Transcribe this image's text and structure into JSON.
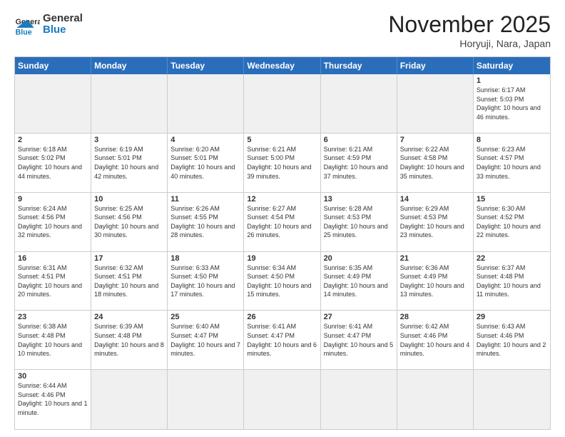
{
  "header": {
    "logo_general": "General",
    "logo_blue": "Blue",
    "month_title": "November 2025",
    "location": "Horyuji, Nara, Japan"
  },
  "day_headers": [
    "Sunday",
    "Monday",
    "Tuesday",
    "Wednesday",
    "Thursday",
    "Friday",
    "Saturday"
  ],
  "cells": [
    {
      "date": "",
      "empty": true,
      "info": ""
    },
    {
      "date": "",
      "empty": true,
      "info": ""
    },
    {
      "date": "",
      "empty": true,
      "info": ""
    },
    {
      "date": "",
      "empty": true,
      "info": ""
    },
    {
      "date": "",
      "empty": true,
      "info": ""
    },
    {
      "date": "",
      "empty": true,
      "info": ""
    },
    {
      "date": "1",
      "empty": false,
      "info": "Sunrise: 6:17 AM\nSunset: 5:03 PM\nDaylight: 10 hours and 46 minutes."
    },
    {
      "date": "2",
      "empty": false,
      "info": "Sunrise: 6:18 AM\nSunset: 5:02 PM\nDaylight: 10 hours and 44 minutes."
    },
    {
      "date": "3",
      "empty": false,
      "info": "Sunrise: 6:19 AM\nSunset: 5:01 PM\nDaylight: 10 hours and 42 minutes."
    },
    {
      "date": "4",
      "empty": false,
      "info": "Sunrise: 6:20 AM\nSunset: 5:01 PM\nDaylight: 10 hours and 40 minutes."
    },
    {
      "date": "5",
      "empty": false,
      "info": "Sunrise: 6:21 AM\nSunset: 5:00 PM\nDaylight: 10 hours and 39 minutes."
    },
    {
      "date": "6",
      "empty": false,
      "info": "Sunrise: 6:21 AM\nSunset: 4:59 PM\nDaylight: 10 hours and 37 minutes."
    },
    {
      "date": "7",
      "empty": false,
      "info": "Sunrise: 6:22 AM\nSunset: 4:58 PM\nDaylight: 10 hours and 35 minutes."
    },
    {
      "date": "8",
      "empty": false,
      "info": "Sunrise: 6:23 AM\nSunset: 4:57 PM\nDaylight: 10 hours and 33 minutes."
    },
    {
      "date": "9",
      "empty": false,
      "info": "Sunrise: 6:24 AM\nSunset: 4:56 PM\nDaylight: 10 hours and 32 minutes."
    },
    {
      "date": "10",
      "empty": false,
      "info": "Sunrise: 6:25 AM\nSunset: 4:56 PM\nDaylight: 10 hours and 30 minutes."
    },
    {
      "date": "11",
      "empty": false,
      "info": "Sunrise: 6:26 AM\nSunset: 4:55 PM\nDaylight: 10 hours and 28 minutes."
    },
    {
      "date": "12",
      "empty": false,
      "info": "Sunrise: 6:27 AM\nSunset: 4:54 PM\nDaylight: 10 hours and 26 minutes."
    },
    {
      "date": "13",
      "empty": false,
      "info": "Sunrise: 6:28 AM\nSunset: 4:53 PM\nDaylight: 10 hours and 25 minutes."
    },
    {
      "date": "14",
      "empty": false,
      "info": "Sunrise: 6:29 AM\nSunset: 4:53 PM\nDaylight: 10 hours and 23 minutes."
    },
    {
      "date": "15",
      "empty": false,
      "info": "Sunrise: 6:30 AM\nSunset: 4:52 PM\nDaylight: 10 hours and 22 minutes."
    },
    {
      "date": "16",
      "empty": false,
      "info": "Sunrise: 6:31 AM\nSunset: 4:51 PM\nDaylight: 10 hours and 20 minutes."
    },
    {
      "date": "17",
      "empty": false,
      "info": "Sunrise: 6:32 AM\nSunset: 4:51 PM\nDaylight: 10 hours and 18 minutes."
    },
    {
      "date": "18",
      "empty": false,
      "info": "Sunrise: 6:33 AM\nSunset: 4:50 PM\nDaylight: 10 hours and 17 minutes."
    },
    {
      "date": "19",
      "empty": false,
      "info": "Sunrise: 6:34 AM\nSunset: 4:50 PM\nDaylight: 10 hours and 15 minutes."
    },
    {
      "date": "20",
      "empty": false,
      "info": "Sunrise: 6:35 AM\nSunset: 4:49 PM\nDaylight: 10 hours and 14 minutes."
    },
    {
      "date": "21",
      "empty": false,
      "info": "Sunrise: 6:36 AM\nSunset: 4:49 PM\nDaylight: 10 hours and 13 minutes."
    },
    {
      "date": "22",
      "empty": false,
      "info": "Sunrise: 6:37 AM\nSunset: 4:48 PM\nDaylight: 10 hours and 11 minutes."
    },
    {
      "date": "23",
      "empty": false,
      "info": "Sunrise: 6:38 AM\nSunset: 4:48 PM\nDaylight: 10 hours and 10 minutes."
    },
    {
      "date": "24",
      "empty": false,
      "info": "Sunrise: 6:39 AM\nSunset: 4:48 PM\nDaylight: 10 hours and 8 minutes."
    },
    {
      "date": "25",
      "empty": false,
      "info": "Sunrise: 6:40 AM\nSunset: 4:47 PM\nDaylight: 10 hours and 7 minutes."
    },
    {
      "date": "26",
      "empty": false,
      "info": "Sunrise: 6:41 AM\nSunset: 4:47 PM\nDaylight: 10 hours and 6 minutes."
    },
    {
      "date": "27",
      "empty": false,
      "info": "Sunrise: 6:41 AM\nSunset: 4:47 PM\nDaylight: 10 hours and 5 minutes."
    },
    {
      "date": "28",
      "empty": false,
      "info": "Sunrise: 6:42 AM\nSunset: 4:46 PM\nDaylight: 10 hours and 4 minutes."
    },
    {
      "date": "29",
      "empty": false,
      "info": "Sunrise: 6:43 AM\nSunset: 4:46 PM\nDaylight: 10 hours and 2 minutes."
    },
    {
      "date": "30",
      "empty": false,
      "info": "Sunrise: 6:44 AM\nSunset: 4:46 PM\nDaylight: 10 hours and 1 minute."
    },
    {
      "date": "",
      "empty": true,
      "info": ""
    },
    {
      "date": "",
      "empty": true,
      "info": ""
    },
    {
      "date": "",
      "empty": true,
      "info": ""
    },
    {
      "date": "",
      "empty": true,
      "info": ""
    },
    {
      "date": "",
      "empty": true,
      "info": ""
    },
    {
      "date": "",
      "empty": true,
      "info": ""
    }
  ]
}
